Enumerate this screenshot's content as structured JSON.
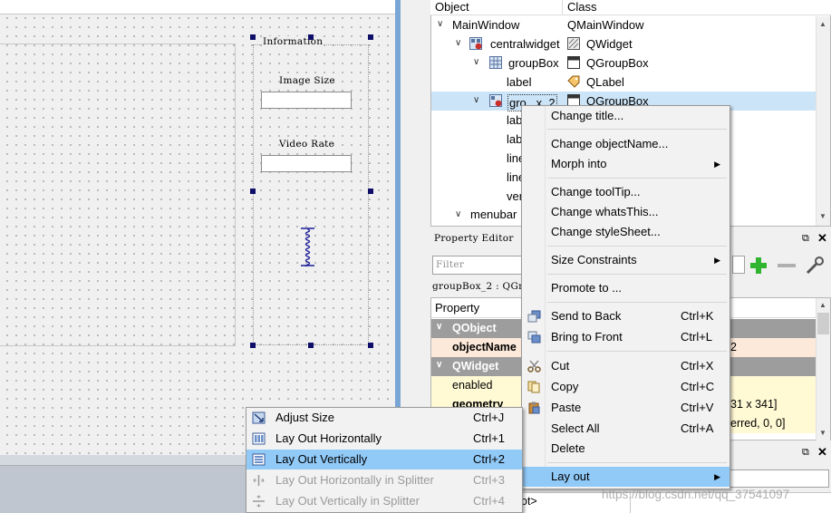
{
  "form": {
    "group_title": "Information",
    "image_size_label": "Image Size",
    "video_rate_label": "Video Rate"
  },
  "inspector": {
    "col_object": "Object",
    "col_class": "Class",
    "rows": [
      {
        "name": "MainWindow",
        "class": "QMainWindow"
      },
      {
        "name": "centralwidget",
        "class": "QWidget"
      },
      {
        "name": "groupBox",
        "class": "QGroupBox"
      },
      {
        "name": "label",
        "class": "QLabel"
      },
      {
        "name": "gro...x_2",
        "class": "QGroupBox"
      },
      {
        "name": "lab",
        "class": ""
      },
      {
        "name": "lab",
        "class": ""
      },
      {
        "name": "line",
        "class": ""
      },
      {
        "name": "line",
        "class": ""
      },
      {
        "name": "ver",
        "class": ""
      },
      {
        "name": "menubar",
        "class": ""
      }
    ]
  },
  "property_editor": {
    "title": "Property Editor",
    "filter_placeholder": "Filter",
    "object_label": "groupBox_2 : QGr",
    "col_property": "Property",
    "rows": [
      {
        "kind": "category",
        "name": "QObject",
        "value": ""
      },
      {
        "kind": "value",
        "name": "objectName",
        "value": "2"
      },
      {
        "kind": "category",
        "name": "QWidget",
        "value": ""
      },
      {
        "kind": "value",
        "name": "enabled",
        "value": ""
      },
      {
        "kind": "value",
        "name": "geometry",
        "value": "31 x 341]"
      },
      {
        "kind": "value",
        "name": "",
        "value": "erred, 0, 0]"
      }
    ]
  },
  "bottom_slot": "ot>",
  "context_menu": {
    "items": [
      {
        "label": "Change title...",
        "shortcut": ""
      },
      {
        "label": "Change objectName...",
        "shortcut": ""
      },
      {
        "label": "Morph into",
        "shortcut": ""
      },
      {
        "label": "Change toolTip...",
        "shortcut": ""
      },
      {
        "label": "Change whatsThis...",
        "shortcut": ""
      },
      {
        "label": "Change styleSheet...",
        "shortcut": ""
      },
      {
        "label": "Size Constraints",
        "shortcut": ""
      },
      {
        "label": "Promote to ...",
        "shortcut": ""
      },
      {
        "label": "Send to Back",
        "shortcut": "Ctrl+K"
      },
      {
        "label": "Bring to Front",
        "shortcut": "Ctrl+L"
      },
      {
        "label": "Cut",
        "shortcut": "Ctrl+X"
      },
      {
        "label": "Copy",
        "shortcut": "Ctrl+C"
      },
      {
        "label": "Paste",
        "shortcut": "Ctrl+V"
      },
      {
        "label": "Select All",
        "shortcut": "Ctrl+A"
      },
      {
        "label": "Delete",
        "shortcut": ""
      },
      {
        "label": "Lay out",
        "shortcut": ""
      }
    ]
  },
  "layout_menu": {
    "items": [
      {
        "label": "Adjust Size",
        "shortcut": "Ctrl+J"
      },
      {
        "label": "Lay Out Horizontally",
        "shortcut": "Ctrl+1"
      },
      {
        "label": "Lay Out Vertically",
        "shortcut": "Ctrl+2"
      },
      {
        "label": "Lay Out Horizontally in Splitter",
        "shortcut": "Ctrl+3"
      },
      {
        "label": "Lay Out Vertically in Splitter",
        "shortcut": "Ctrl+4"
      }
    ]
  },
  "watermark": "https://blog.csdn.net/qq_37541097",
  "colors": {
    "highlight": "#91c9f7",
    "selection": "#cce4f7",
    "category": "#9d9d9d",
    "plus_green": "#2fb52f"
  }
}
